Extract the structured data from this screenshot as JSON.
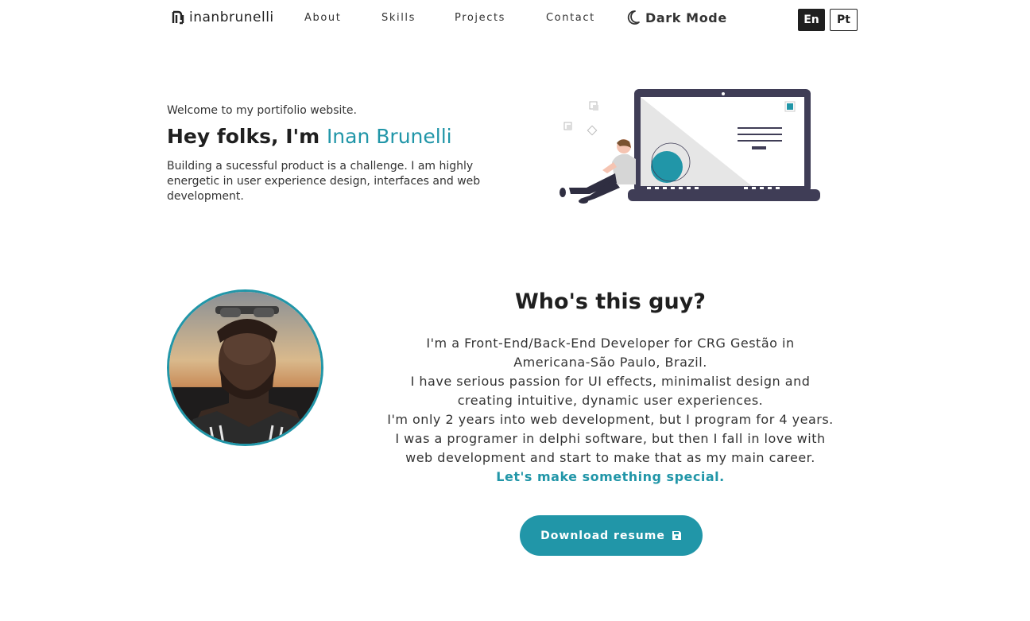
{
  "nav": {
    "logo_text": "inanbrunelli",
    "links": [
      "About",
      "Skills",
      "Projects",
      "Contact"
    ],
    "dark_mode_label": "Dark Mode",
    "lang_en": "En",
    "lang_pt": "Pt"
  },
  "hero": {
    "welcome": "Welcome to my portifolio website.",
    "greeting": "Hey folks, I'm",
    "name": "Inan Brunelli",
    "subtitle": "Building a sucessful product is a challenge. I am highly energetic in user experience design, interfaces and web development."
  },
  "about": {
    "title": "Who's this guy?",
    "lines": [
      "I'm a Front-End/Back-End Developer for CRG Gestão in",
      "Americana-São Paulo, Brazil.",
      "I have serious passion for UI effects, minimalist design and",
      "creating intuitive, dynamic user experiences.",
      "I'm only 2 years into web development, but I program for 4 years.",
      "I was a programer in delphi software, but then I fall in love with",
      "web development and start to make that as my main career."
    ],
    "cta": "Let's make something special.",
    "resume_label": "Download resume"
  },
  "colors": {
    "accent": "#2196a8",
    "dark": "#1f1f1f",
    "laptop": "#3f3d56"
  },
  "icons": {
    "logo": "logo-mark-icon",
    "dark_mode": "moon-icon",
    "resume": "floppy-disk-icon"
  }
}
